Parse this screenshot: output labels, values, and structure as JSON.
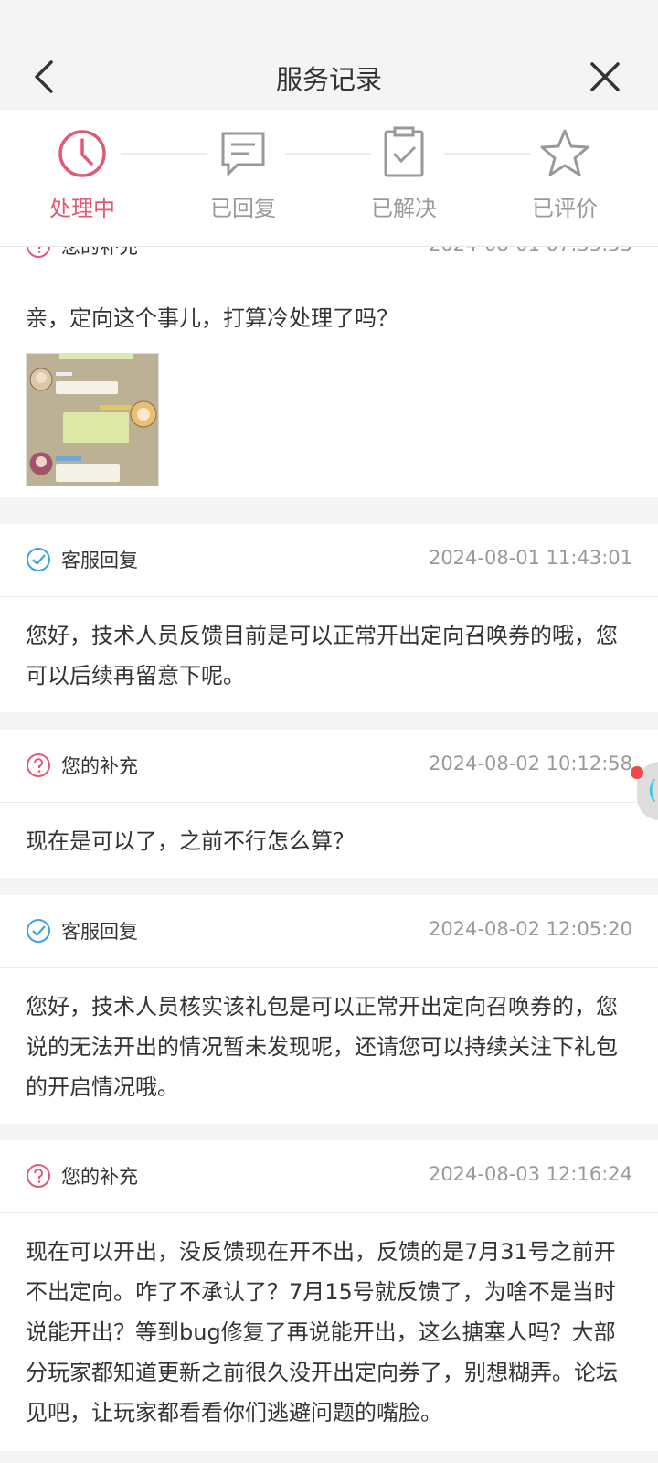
{
  "header": {
    "title": "服务记录"
  },
  "steps": [
    {
      "label": "处理中",
      "icon": "clock-icon",
      "active": true
    },
    {
      "label": "已回复",
      "icon": "message-icon",
      "active": false
    },
    {
      "label": "已解决",
      "icon": "clipboard-check-icon",
      "active": false
    },
    {
      "label": "已评价",
      "icon": "star-icon",
      "active": false
    }
  ],
  "colors": {
    "accent": "#e05a78",
    "inactive": "#999999",
    "agent_reply": "#3fa3d8"
  },
  "records": [
    {
      "who": "您的补充",
      "time": "2024-08-01 07:35:53",
      "text": "亲，定向这个事儿，打算冷处理了吗？",
      "has_image": true
    },
    {
      "who": "客服回复",
      "time": "2024-08-01 11:43:01",
      "text": "您好，技术人员反馈目前是可以正常开出定向召唤券的哦，您可以后续再留意下呢。"
    },
    {
      "who": "您的补充",
      "time": "2024-08-02 10:12:58",
      "text": "现在是可以了，之前不行怎么算？"
    },
    {
      "who": "客服回复",
      "time": "2024-08-02 12:05:20",
      "text": "您好，技术人员核实该礼包是可以正常开出定向召唤券的，您说的无法开出的情况暂未发现呢，还请您可以持续关注下礼包的开启情况哦。"
    },
    {
      "who": "您的补充",
      "time": "2024-08-03 12:16:24",
      "text": "现在可以开出，没反馈现在开不出，反馈的是7月31号之前开不出定向。咋了不承认了？7月15号就反馈了，为啥不是当时说能开出？等到bug修复了再说能开出，这么搪塞人吗？大部分玩家都知道更新之前很久没开出定向券了，别想糊弄。论坛见吧，让玩家都看看你们逃避问题的嘴脸。"
    }
  ],
  "attachment_text": {
    "line1": "确实，都不能开了",
    "line2": "为了新关张大开不出定向来的bug，这是要冷处理吗",
    "line3": "是的，你是这大哥怎么了"
  }
}
